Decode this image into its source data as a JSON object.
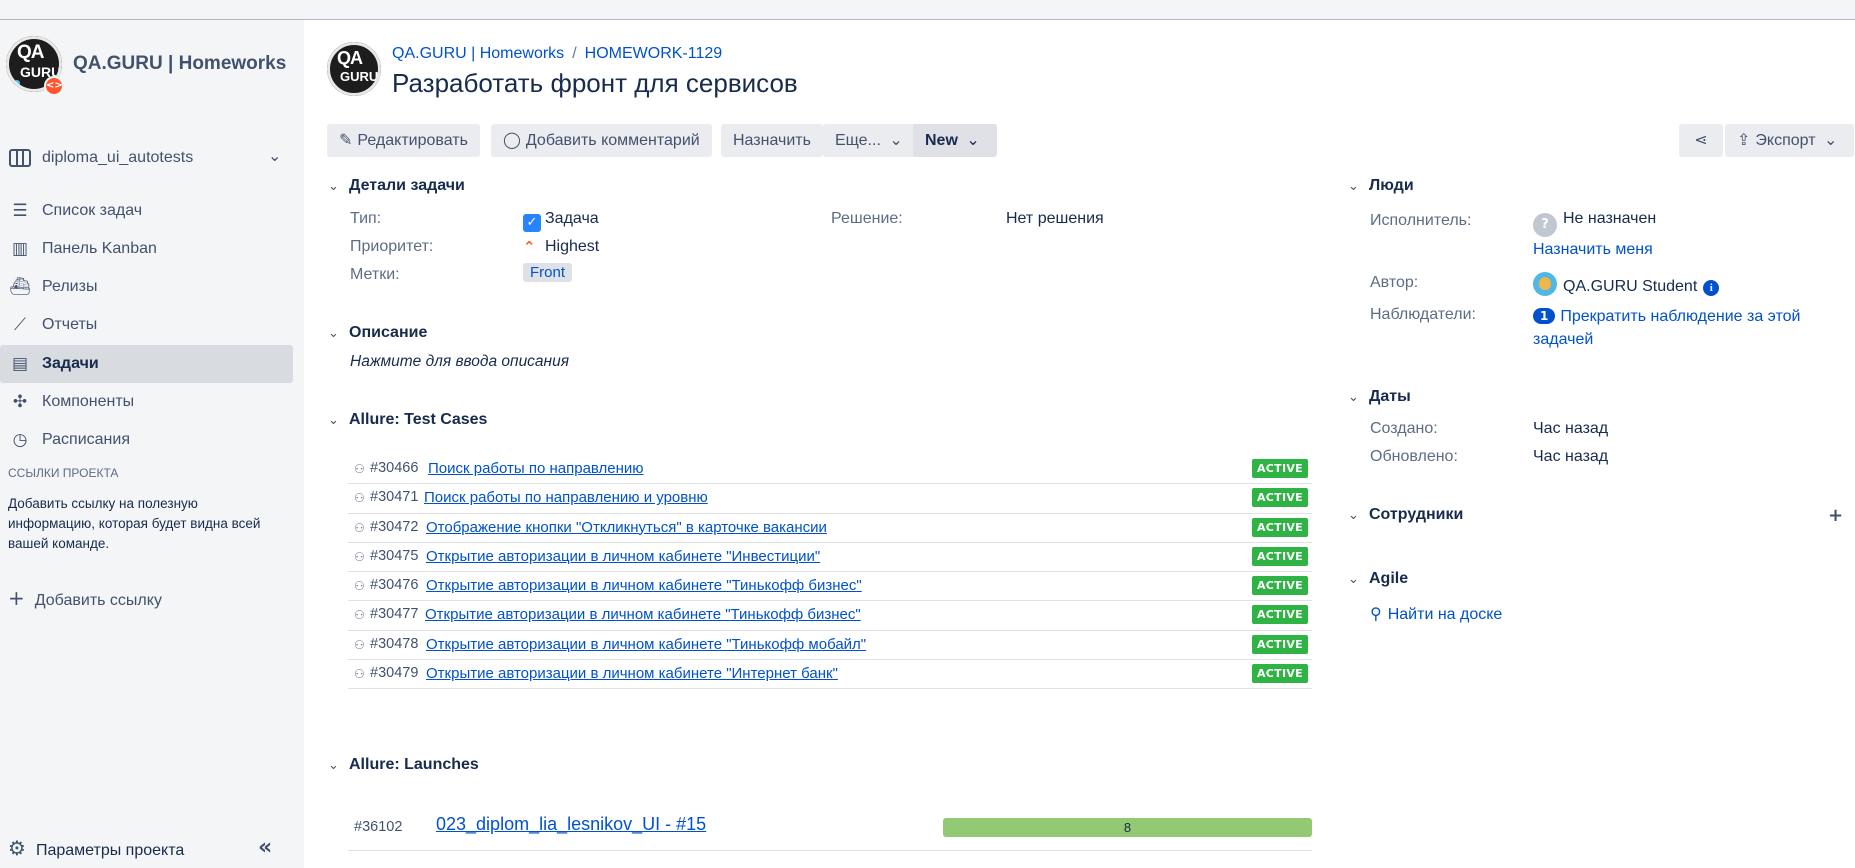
{
  "sidebar": {
    "project_name": "QA.GURU | Homeworks",
    "logo_text_top": "QA",
    "logo_text_bottom": "GURU",
    "board_selector": "diploma_ui_autotests",
    "nav": [
      {
        "label": "Список задач",
        "icon": "list-icon",
        "active": false
      },
      {
        "label": "Панель Kanban",
        "icon": "kanban-icon",
        "active": false
      },
      {
        "label": "Релизы",
        "icon": "ship-icon",
        "active": false
      },
      {
        "label": "Отчеты",
        "icon": "chart-icon",
        "active": false
      },
      {
        "label": "Задачи",
        "icon": "issues-icon",
        "active": true
      },
      {
        "label": "Компоненты",
        "icon": "puzzle-icon",
        "active": false
      },
      {
        "label": "Расписания",
        "icon": "clock-icon",
        "active": false
      }
    ],
    "links_heading": "ССЫЛКИ ПРОЕКТА",
    "links_text": "Добавить ссылку на полезную информацию, которая будет видна всей вашей команде.",
    "add_link": "Добавить ссылку",
    "settings": "Параметры проекта"
  },
  "header": {
    "breadcrumb_project": "QA.GURU | Homeworks",
    "breadcrumb_issue": "HOMEWORK-1129",
    "title": "Разработать фронт для сервисов"
  },
  "toolbar": {
    "edit": "Редактировать",
    "comment": "Добавить комментарий",
    "assign": "Назначить",
    "more": "Еще...",
    "status": "New",
    "export": "Экспорт"
  },
  "details": {
    "heading": "Детали задачи",
    "type_label": "Тип:",
    "type_value": "Задача",
    "priority_label": "Приоритет:",
    "priority_value": "Highest",
    "labels_label": "Метки:",
    "labels_value": "Front",
    "resolution_label": "Решение:",
    "resolution_value": "Нет решения"
  },
  "description": {
    "heading": "Описание",
    "placeholder": "Нажмите для ввода описания"
  },
  "test_cases": {
    "heading": "Allure: Test Cases",
    "rows": [
      {
        "id": "#30466",
        "name": "Поиск работы по направлению",
        "status": "ACTIVE"
      },
      {
        "id": "#30471",
        "name": "Поиск работы по направлению и уровню",
        "status": "ACTIVE"
      },
      {
        "id": "#30472",
        "name": "Отображение кнопки \"Откликнуться\" в карточке вакансии",
        "status": "ACTIVE"
      },
      {
        "id": "#30475",
        "name": "Открытие авторизации в личном кабинете \"Инвестиции\"",
        "status": "ACTIVE"
      },
      {
        "id": "#30476",
        "name": "Открытие авторизации в личном кабинете \"Тинькофф бизнес\"",
        "status": "ACTIVE"
      },
      {
        "id": "#30477",
        "name": "Открытие авторизации в личном кабинете \"Тинькофф бизнес\"",
        "status": "ACTIVE"
      },
      {
        "id": "#30478",
        "name": "Открытие авторизации в личном кабинете \"Тинькофф мобайл\"",
        "status": "ACTIVE"
      },
      {
        "id": "#30479",
        "name": "Открытие авторизации в личном кабинете \"Интернет банк\"",
        "status": "ACTIVE"
      }
    ]
  },
  "launches": {
    "heading": "Allure: Launches",
    "rows": [
      {
        "id": "#36102",
        "name": "023_diplom_lia_lesnikov_UI - #15",
        "count": "8"
      }
    ]
  },
  "people": {
    "heading": "Люди",
    "assignee_label": "Исполнитель:",
    "assignee_value": "Не назначен",
    "assign_me": "Назначить меня",
    "reporter_label": "Автор:",
    "reporter_value": "QA.GURU Student",
    "watchers_label": "Наблюдатели:",
    "watchers_count": "1",
    "watchers_action": "Прекратить наблюдение за этой задачей"
  },
  "dates": {
    "heading": "Даты",
    "created_label": "Создано:",
    "created_value": "Час назад",
    "updated_label": "Обновлено:",
    "updated_value": "Час назад"
  },
  "employees": {
    "heading": "Сотрудники"
  },
  "agile": {
    "heading": "Agile",
    "find_on_board": "Найти на доске"
  },
  "colors": {
    "link": "#0052cc",
    "active_badge": "#2fb344",
    "launch_bar": "#94c973",
    "sidebar_bg": "#f4f5f7"
  }
}
